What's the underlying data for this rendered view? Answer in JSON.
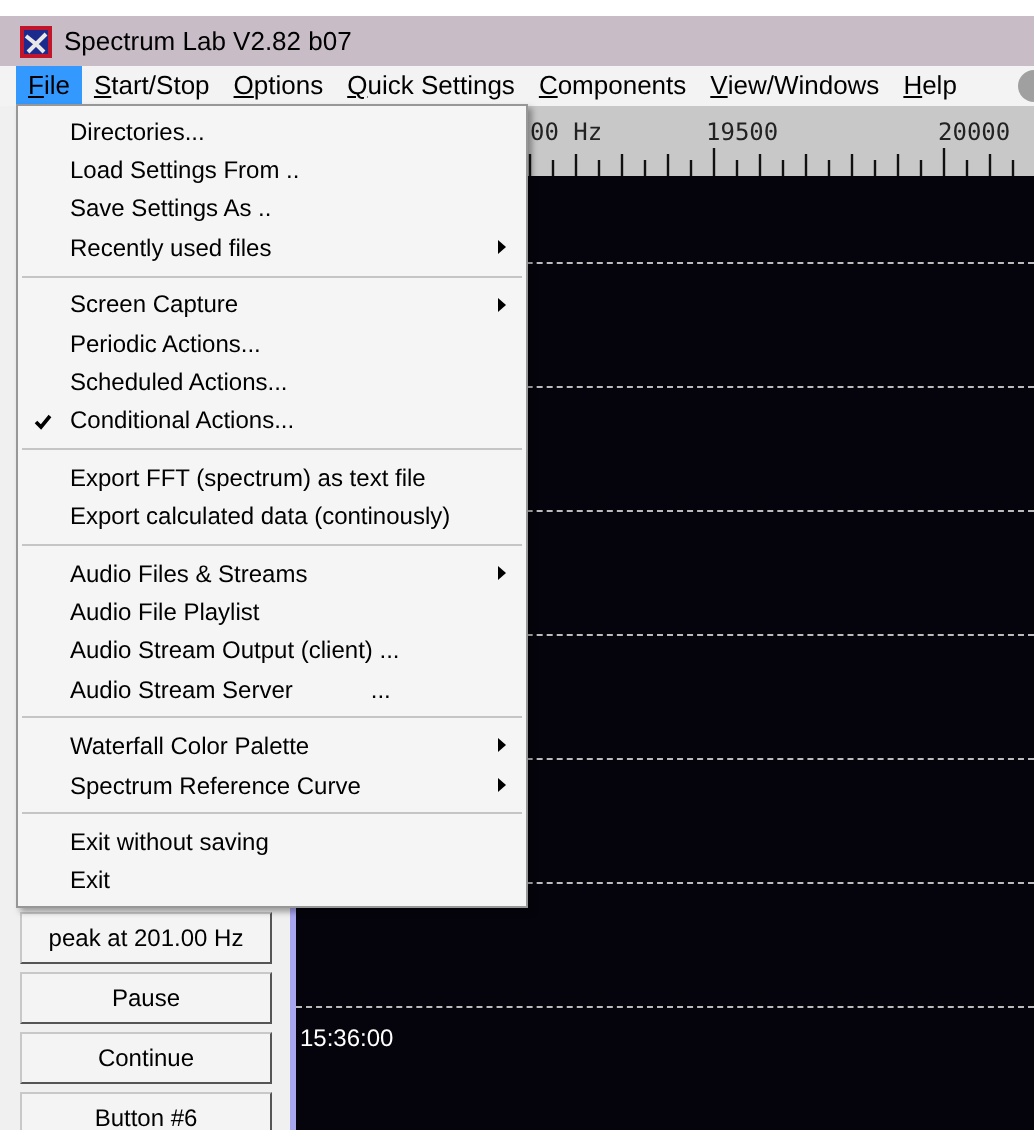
{
  "window": {
    "title": "Spectrum Lab V2.82 b07"
  },
  "menu_bar": [
    {
      "label": "File",
      "selected": true
    },
    {
      "label": "Start/Stop",
      "selected": false
    },
    {
      "label": "Options",
      "selected": false
    },
    {
      "label": "Quick Settings",
      "selected": false
    },
    {
      "label": "Components",
      "selected": false
    },
    {
      "label": "View/Windows",
      "selected": false
    },
    {
      "label": "Help",
      "selected": false
    }
  ],
  "file_menu": [
    {
      "kind": "item",
      "label": "Directories...",
      "checked": false,
      "has_submenu": false
    },
    {
      "kind": "item",
      "label": "Load Settings From ..",
      "checked": false,
      "has_submenu": false
    },
    {
      "kind": "item",
      "label": "Save Settings As ..",
      "checked": false,
      "has_submenu": false
    },
    {
      "kind": "item",
      "label": "Recently used files",
      "checked": false,
      "has_submenu": true
    },
    {
      "kind": "separator"
    },
    {
      "kind": "item",
      "label": "Screen Capture",
      "checked": false,
      "has_submenu": true
    },
    {
      "kind": "item",
      "label": "Periodic Actions...",
      "checked": false,
      "has_submenu": false
    },
    {
      "kind": "item",
      "label": "Scheduled Actions...",
      "checked": false,
      "has_submenu": false
    },
    {
      "kind": "item",
      "label": "Conditional Actions...",
      "checked": true,
      "has_submenu": false
    },
    {
      "kind": "separator"
    },
    {
      "kind": "item",
      "label": "Export FFT (spectrum) as text file",
      "checked": false,
      "has_submenu": false
    },
    {
      "kind": "item",
      "label": "Export calculated data (continously)",
      "checked": false,
      "has_submenu": false
    },
    {
      "kind": "separator"
    },
    {
      "kind": "item",
      "label": "Audio Files & Streams",
      "checked": false,
      "has_submenu": true
    },
    {
      "kind": "item",
      "label": "Audio File Playlist",
      "checked": false,
      "has_submenu": false
    },
    {
      "kind": "item",
      "label": "Audio Stream Output (client) ...",
      "checked": false,
      "has_submenu": false
    },
    {
      "kind": "item",
      "label": "Audio Stream Server",
      "shortcut": "...",
      "checked": false,
      "has_submenu": false
    },
    {
      "kind": "separator"
    },
    {
      "kind": "item",
      "label": "Waterfall Color Palette",
      "checked": false,
      "has_submenu": true
    },
    {
      "kind": "item",
      "label": "Spectrum Reference Curve",
      "checked": false,
      "has_submenu": true
    },
    {
      "kind": "separator"
    },
    {
      "kind": "item",
      "label": "Exit without saving",
      "checked": false,
      "has_submenu": false
    },
    {
      "kind": "item",
      "label": "Exit",
      "checked": false,
      "has_submenu": false
    }
  ],
  "frequency_ruler": {
    "labels": [
      "00 Hz",
      "19500",
      "20000"
    ]
  },
  "waterfall": {
    "time_labels": [
      "15:36:00"
    ]
  },
  "side_buttons": [
    "peak at 201.00 Hz",
    "Pause",
    "Continue",
    "Button #6"
  ]
}
